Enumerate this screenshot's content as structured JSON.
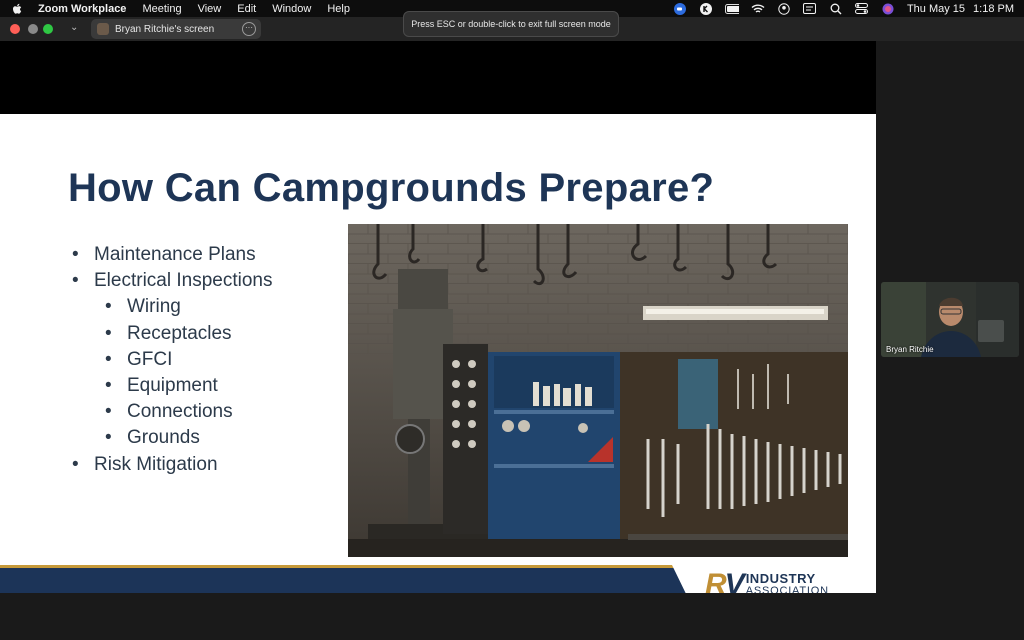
{
  "menubar": {
    "app_name": "Zoom Workplace",
    "items": [
      "Meeting",
      "View",
      "Edit",
      "Window",
      "Help"
    ],
    "tray_icons": [
      "zoom-status-icon",
      "k-app-icon",
      "battery-icon",
      "wifi-icon",
      "user-icon",
      "display-icon",
      "search-icon",
      "control-center-icon",
      "siri-icon"
    ],
    "clock_day": "Thu May 15",
    "clock_time": "1:18 PM"
  },
  "toolbar": {
    "share_label": "Bryan Ritchie's screen",
    "notice": "Press ESC or double-click to exit full screen mode"
  },
  "slide": {
    "title": "How Can Campgrounds Prepare?",
    "bullets": [
      {
        "text": "Maintenance Plans",
        "level": 1
      },
      {
        "text": "Electrical Inspections",
        "level": 1
      },
      {
        "text": "Wiring",
        "level": 2
      },
      {
        "text": "Receptacles",
        "level": 2
      },
      {
        "text": "GFCI",
        "level": 2
      },
      {
        "text": "Equipment",
        "level": 2
      },
      {
        "text": "Connections",
        "level": 2
      },
      {
        "text": "Grounds",
        "level": 2
      },
      {
        "text": "Risk Mitigation",
        "level": 1
      }
    ],
    "logo": {
      "rv": "RV",
      "line1": "INDUSTRY",
      "line2": "ASSOCIATION"
    }
  },
  "participant": {
    "name": "Bryan Ritchie"
  },
  "colors": {
    "title": "#1e3556",
    "footer": "#1c3458",
    "accent": "#c79a3a"
  }
}
